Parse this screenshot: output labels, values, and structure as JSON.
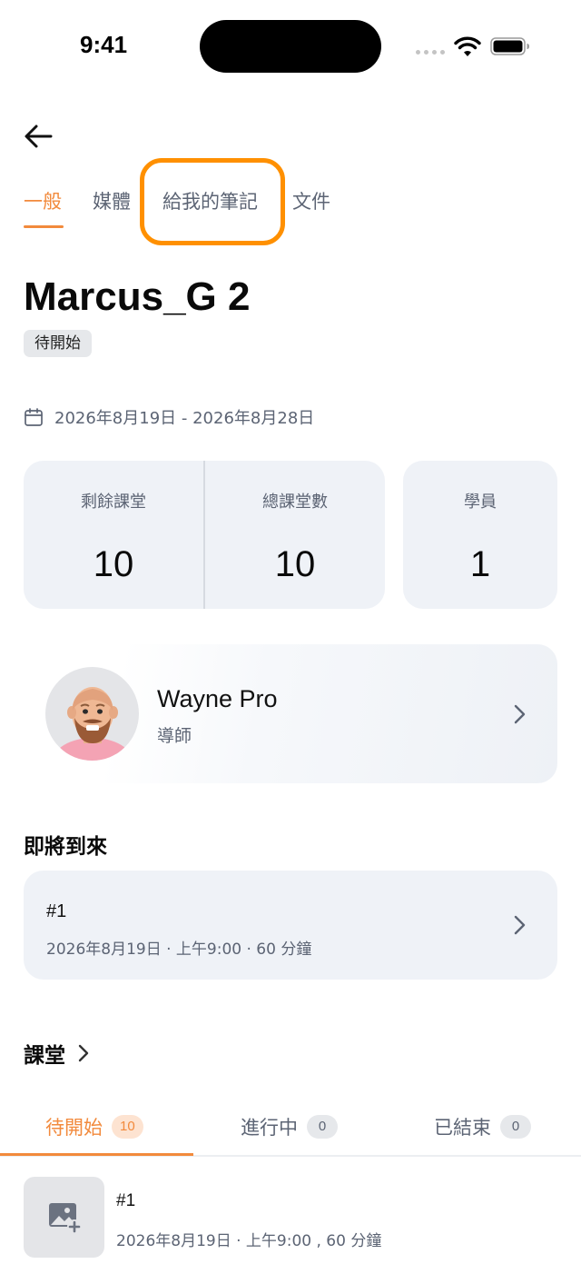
{
  "status_bar": {
    "time": "9:41"
  },
  "tabs": [
    {
      "label": "一般"
    },
    {
      "label": "媒體"
    },
    {
      "label": "給我的筆記"
    },
    {
      "label": "文件"
    }
  ],
  "course": {
    "title": "Marcus_G 2",
    "status": "待開始",
    "date_range": "2026年8月19日 - 2026年8月28日"
  },
  "stats": {
    "remaining": {
      "label": "剩餘課堂",
      "value": "10"
    },
    "total": {
      "label": "總課堂數",
      "value": "10"
    },
    "students": {
      "label": "學員",
      "value": "1"
    }
  },
  "tutor": {
    "name": "Wayne Pro",
    "role": "導師"
  },
  "upcoming": {
    "title": "即將到來",
    "number": "#1",
    "meta": "2026年8月19日 · 上午9:00 · 60 分鐘"
  },
  "lessons": {
    "title": "課堂",
    "tabs": [
      {
        "label": "待開始",
        "count": "10"
      },
      {
        "label": "進行中",
        "count": "0"
      },
      {
        "label": "已結束",
        "count": "0"
      }
    ],
    "items": [
      {
        "number": "#1",
        "meta": "2026年8月19日 · 上午9:00 , 60 分鐘"
      }
    ]
  },
  "colors": {
    "accent": "#f28a3c",
    "highlight": "#ff9000",
    "card": "#eff2f7",
    "muted_text": "#5c6474"
  }
}
